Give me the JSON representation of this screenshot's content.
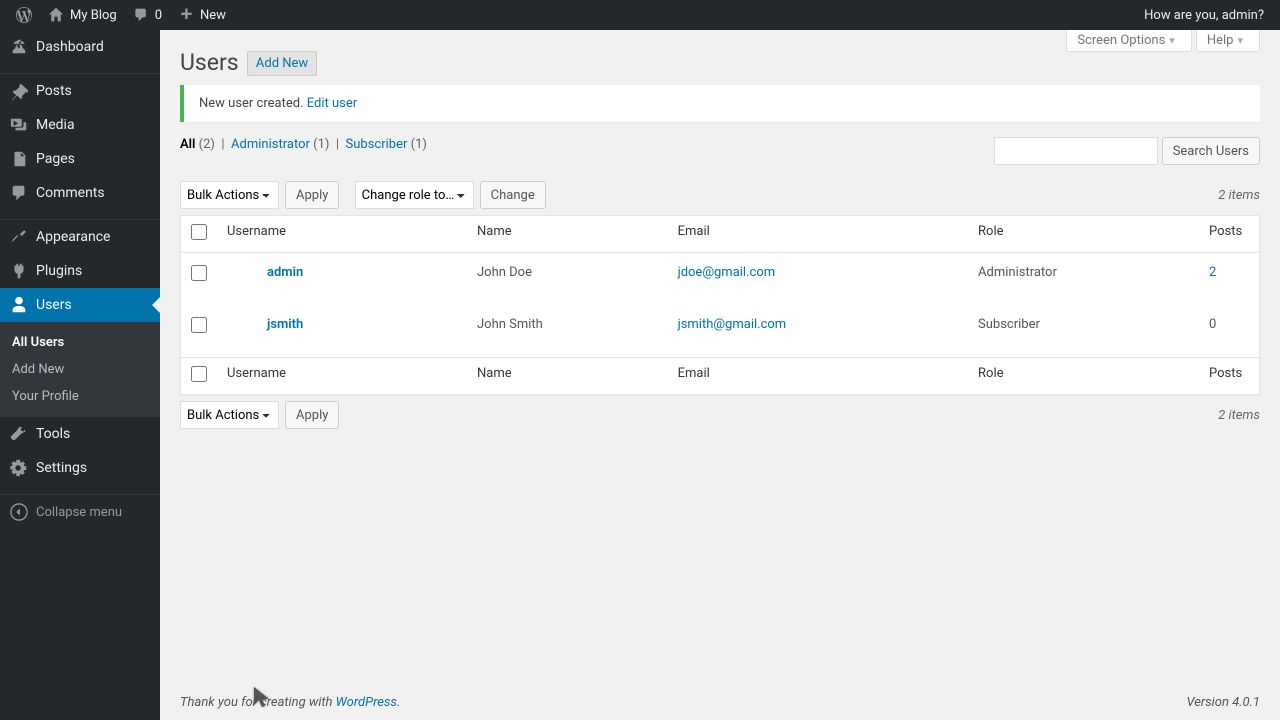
{
  "adminbar": {
    "site_name": "My Blog",
    "comments_count": "0",
    "new_label": "New",
    "greeting": "How are you, admin?"
  },
  "sidebar": {
    "items": [
      {
        "label": "Dashboard"
      },
      {
        "label": "Posts"
      },
      {
        "label": "Media"
      },
      {
        "label": "Pages"
      },
      {
        "label": "Comments"
      },
      {
        "label": "Appearance"
      },
      {
        "label": "Plugins"
      },
      {
        "label": "Users"
      },
      {
        "label": "Tools"
      },
      {
        "label": "Settings"
      }
    ],
    "submenu": {
      "items": [
        {
          "label": "All Users"
        },
        {
          "label": "Add New"
        },
        {
          "label": "Your Profile"
        }
      ]
    },
    "collapse_label": "Collapse menu"
  },
  "screen_meta": {
    "screen_options": "Screen Options",
    "help": "Help"
  },
  "page": {
    "title": "Users",
    "add_new": "Add New"
  },
  "notice": {
    "text": "New user created.",
    "link": "Edit user"
  },
  "filters": {
    "all_label": "All",
    "all_count": "(2)",
    "admin_label": "Administrator",
    "admin_count": "(1)",
    "sub_label": "Subscriber",
    "sub_count": "(1)"
  },
  "search": {
    "button": "Search Users"
  },
  "bulk": {
    "actions_label": "Bulk Actions",
    "apply": "Apply",
    "change_role": "Change role to…",
    "change": "Change"
  },
  "items_count": "2 items",
  "columns": {
    "username": "Username",
    "name": "Name",
    "email": "Email",
    "role": "Role",
    "posts": "Posts"
  },
  "users": [
    {
      "username": "admin",
      "name": "John Doe",
      "email": "jdoe@gmail.com",
      "role": "Administrator",
      "posts": "2",
      "posts_link": true
    },
    {
      "username": "jsmith",
      "name": "John Smith",
      "email": "jsmith@gmail.com",
      "role": "Subscriber",
      "posts": "0",
      "posts_link": false
    }
  ],
  "footer": {
    "thankyou_prefix": "Thank you for creating with ",
    "wordpress": "WordPress",
    "period": ".",
    "version": "Version 4.0.1"
  }
}
